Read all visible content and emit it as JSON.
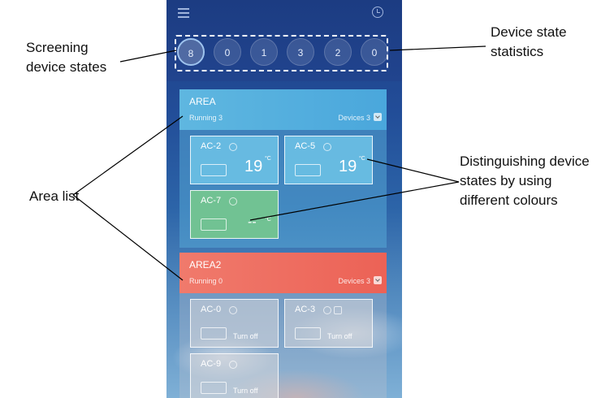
{
  "annotations": {
    "screening": [
      "Screening",
      "device states"
    ],
    "statistics": [
      "Device state",
      "statistics"
    ],
    "area_list": "Area list",
    "colours": [
      "Distinguishing device",
      "states by using",
      "different colours"
    ]
  },
  "stats": [
    "8",
    "0",
    "1",
    "3",
    "2",
    "0"
  ],
  "areas": [
    {
      "name": "AREA",
      "running": "Running 3",
      "devices": "Devices 3",
      "color": "#4aa7dc",
      "cards": [
        {
          "name": "AC-2",
          "temp": "19",
          "unit": "°C",
          "status": "running",
          "color": "#6ec4e8"
        },
        {
          "name": "AC-5",
          "temp": "19",
          "unit": "°C",
          "status": "running",
          "color": "#6ec4e8"
        },
        {
          "name": "AC-7",
          "temp": "--",
          "unit": "°C",
          "status": "fault",
          "color": "#71c293"
        }
      ]
    },
    {
      "name": "AREA2",
      "running": "Running 0",
      "devices": "Devices 3",
      "color": "#ec6256",
      "cards": [
        {
          "name": "AC-0",
          "state": "Turn off"
        },
        {
          "name": "AC-3",
          "state": "Turn off"
        },
        {
          "name": "AC-9",
          "state": "Turn off"
        }
      ]
    }
  ],
  "icons": {
    "menu": "menu-icon",
    "history": "clock-icon",
    "fan": "fan-icon",
    "lock": "lock-icon",
    "ac_unit": "ac-unit-icon",
    "expand": "chevron-down-icon"
  }
}
